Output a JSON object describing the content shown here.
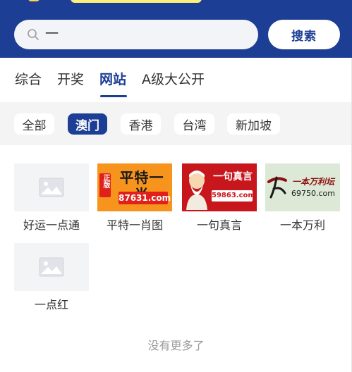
{
  "colors": {
    "brand": "#1c3e94",
    "region_bar_bg": "#f4f4f5",
    "placeholder_bg": "#f3f4f6"
  },
  "search": {
    "value": "一",
    "icon": "search-icon",
    "button_label": "搜索"
  },
  "tabs": [
    {
      "label": "综合",
      "active": false
    },
    {
      "label": "开奖",
      "active": false
    },
    {
      "label": "网站",
      "active": true
    },
    {
      "label": "A级大公开",
      "active": false
    }
  ],
  "regions": [
    {
      "label": "全部",
      "active": false
    },
    {
      "label": "澳门",
      "active": true
    },
    {
      "label": "香港",
      "active": false
    },
    {
      "label": "台湾",
      "active": false
    },
    {
      "label": "新加坡",
      "active": false
    }
  ],
  "sites": [
    {
      "name": "好运一点通",
      "thumb": "image-placeholder-icon"
    },
    {
      "name": "平特一肖图",
      "thumb_tag": "正版",
      "thumb_title": "平特一肖",
      "thumb_url": "87631.com"
    },
    {
      "name": "一句真言",
      "thumb_title": "一句真言",
      "thumb_url": "59863.com"
    },
    {
      "name": "一本万利",
      "thumb_title": "一本万利坛",
      "thumb_url": "69750.com"
    },
    {
      "name": "一点红",
      "thumb": "image-placeholder-icon"
    }
  ],
  "footer": {
    "no_more": "没有更多了"
  }
}
